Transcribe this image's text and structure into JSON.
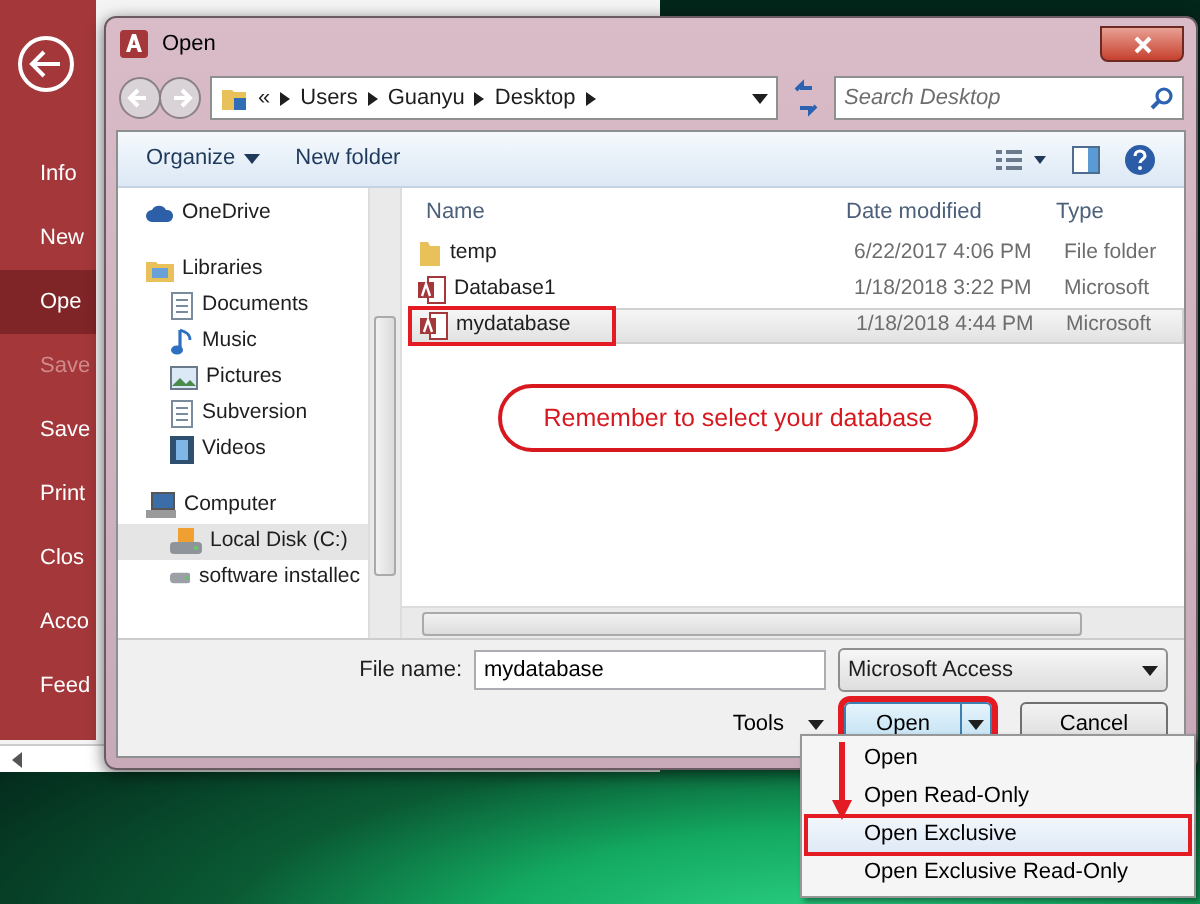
{
  "backstage": {
    "items": [
      {
        "label": "Info",
        "selected": false,
        "disabled": false
      },
      {
        "label": "New",
        "selected": false,
        "disabled": false
      },
      {
        "label": "Ope",
        "selected": true,
        "disabled": false
      },
      {
        "label": "Save",
        "selected": false,
        "disabled": true
      },
      {
        "label": "Save",
        "selected": false,
        "disabled": false
      },
      {
        "label": "Print",
        "selected": false,
        "disabled": false
      },
      {
        "label": "Clos",
        "selected": false,
        "disabled": false
      },
      {
        "label": "Acco",
        "selected": false,
        "disabled": false
      },
      {
        "label": "Feed",
        "selected": false,
        "disabled": false
      }
    ]
  },
  "dialog": {
    "title": "Open",
    "breadcrumb": [
      "Users",
      "Guanyu",
      "Desktop"
    ],
    "breadcrumb_overflow": "«",
    "search": {
      "placeholder": "Search Desktop"
    },
    "toolbar": [
      "Organize",
      "New folder"
    ],
    "nav": [
      {
        "label": "OneDrive",
        "kind": "cloud",
        "selected": false
      },
      {
        "label": "Libraries",
        "kind": "library",
        "selected": false,
        "children": [
          {
            "label": "Documents",
            "kind": "documents",
            "selected": false
          },
          {
            "label": "Music",
            "kind": "music",
            "selected": false
          },
          {
            "label": "Pictures",
            "kind": "pictures",
            "selected": false
          },
          {
            "label": "Subversion",
            "kind": "documents",
            "selected": false
          },
          {
            "label": "Videos",
            "kind": "videos",
            "selected": false
          }
        ]
      },
      {
        "label": "Computer",
        "kind": "computer",
        "selected": false,
        "children": [
          {
            "label": "Local Disk (C:)",
            "kind": "disk",
            "selected": true
          },
          {
            "label": "software installec",
            "kind": "drive",
            "selected": false
          }
        ]
      }
    ],
    "columns": [
      "Name",
      "Date modified",
      "Type"
    ],
    "files": [
      {
        "name": "temp",
        "date": "6/22/2017 4:06 PM",
        "type": "File folder",
        "kind": "folder",
        "selected": false,
        "highlighted": false
      },
      {
        "name": "Database1",
        "date": "1/18/2018 3:22 PM",
        "type": "Microsoft",
        "kind": "access",
        "selected": false,
        "highlighted": false
      },
      {
        "name": "mydatabase",
        "date": "1/18/2018 4:44 PM",
        "type": "Microsoft",
        "kind": "access",
        "selected": true,
        "highlighted": true
      }
    ],
    "callout": "Remember to select your database",
    "file_name_label": "File name:",
    "file_name": "mydatabase",
    "file_type": "Microsoft Access",
    "tools": "Tools",
    "open_button": {
      "label": "Open",
      "highlighted": true
    },
    "cancel_button": "Cancel",
    "open_menu": [
      {
        "label": "Open",
        "selected": false,
        "highlighted": false
      },
      {
        "label": "Open Read-Only",
        "selected": false,
        "highlighted": false
      },
      {
        "label": "Open Exclusive",
        "selected": true,
        "highlighted": true
      },
      {
        "label": "Open Exclusive Read-Only",
        "selected": false,
        "highlighted": false
      }
    ]
  }
}
